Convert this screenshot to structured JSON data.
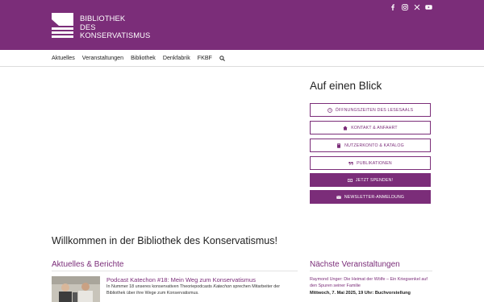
{
  "header": {
    "logo_lines": [
      "BIBLIOTHEK",
      "DES",
      "KONSERVATISMUS"
    ],
    "social_icons": [
      "facebook-icon",
      "instagram-icon",
      "x-icon",
      "youtube-icon"
    ]
  },
  "nav": {
    "items": [
      "Aktuelles",
      "Veranstaltungen",
      "Bibliothek",
      "Denkfabrik",
      "FKBF"
    ]
  },
  "sidebar": {
    "title": "Auf einen Blick",
    "buttons": [
      {
        "label": "ÖFFNUNGSZEITEN DES LESESAALS",
        "icon": "clock-icon"
      },
      {
        "label": "KONTAKT & ANFAHRT",
        "icon": "home-icon"
      },
      {
        "label": "NUTZERKONTO & KATALOG",
        "icon": "book-icon"
      },
      {
        "label": "PUBLIKATIONEN",
        "icon": "quote-icon"
      },
      {
        "label": "JETZT SPENDEN!",
        "icon": "money-icon"
      },
      {
        "label": "NEWSLETTER-ANMELDUNG",
        "icon": "envelope-icon"
      }
    ]
  },
  "main": {
    "welcome": "Willkommen in der Bibliothek des Konservatismus!",
    "news_heading": "Aktuelles & Berichte",
    "events_heading": "Nächste Veranstaltungen",
    "post": {
      "title": "Podcast Katechon #18: Mein Weg zum Konservatismus",
      "text_before": "In Nummer 18 unseres konservativen Theoriepodcasts ",
      "text_italic": "Katechon",
      "text_after": " sprechen Mitarbeiter der Bibliothek über ihre Wege zum Konservatismus."
    },
    "event": {
      "title": "Raymond Unger: Die Heimat der Wölfe – Ein Kriegsenkel auf den Spuren seiner Familie",
      "date": "Mittwoch, 7. Mai 2025, 19 Uhr: Buchvorstellung"
    }
  },
  "colors": {
    "brand": "#7b2d79",
    "header_bg": "#7b2d79",
    "text": "#222222"
  }
}
